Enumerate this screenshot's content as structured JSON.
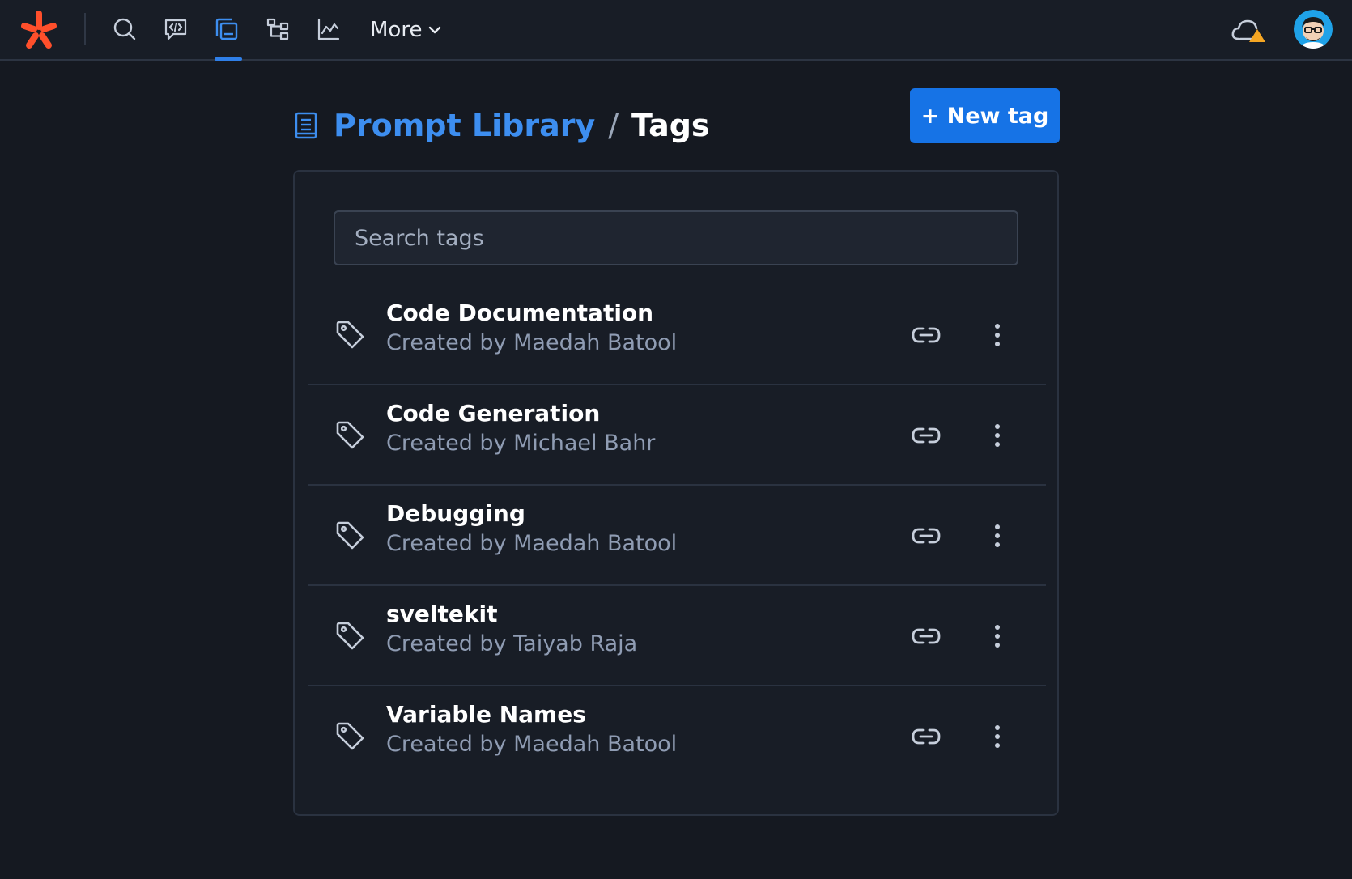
{
  "nav": {
    "logo": "zapier-logo-icon",
    "items": [
      {
        "icon": "search-icon"
      },
      {
        "icon": "chat-code-icon"
      },
      {
        "icon": "prompt-library-icon",
        "active": true
      },
      {
        "icon": "tree-structure-icon"
      },
      {
        "icon": "chart-line-icon"
      }
    ],
    "more_label": "More",
    "accent_color": "#2f7fe8",
    "status_icon": "cloud-warning-icon",
    "avatar_icon": "user-avatar-icon"
  },
  "breadcrumb": {
    "root": "Prompt Library",
    "separator": "/",
    "current": "Tags"
  },
  "new_tag_button": {
    "label": "+ New tag",
    "color": "#1673e6"
  },
  "search": {
    "placeholder": "Search tags",
    "value": ""
  },
  "tags": [
    {
      "name": "Code Documentation",
      "creator": "Created by Maedah Batool"
    },
    {
      "name": "Code Generation",
      "creator": "Created by Michael Bahr"
    },
    {
      "name": "Debugging",
      "creator": "Created by Maedah Batool"
    },
    {
      "name": "sveltekit",
      "creator": "Created by Taiyab Raja"
    },
    {
      "name": "Variable Names",
      "creator": "Created by Maedah Batool"
    }
  ]
}
